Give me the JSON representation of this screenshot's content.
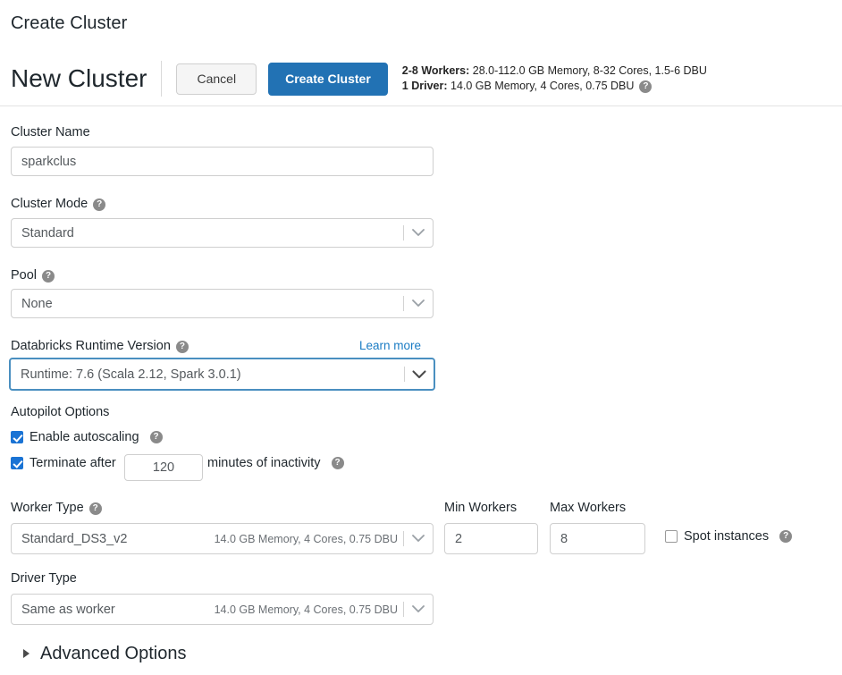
{
  "page": {
    "title": "Create Cluster"
  },
  "header": {
    "cluster_heading": "New Cluster",
    "cancel_label": "Cancel",
    "create_label": "Create Cluster",
    "specs": {
      "workers_prefix": "2-8 Workers:",
      "workers_detail": " 28.0-112.0 GB Memory, 8-32 Cores, 1.5-6 DBU",
      "driver_prefix": "1 Driver:",
      "driver_detail": " 14.0 GB Memory, 4 Cores, 0.75 DBU",
      "help_icon": "help-icon",
      "help_glyph": "?"
    },
    "accent_color": "#2272b4"
  },
  "form": {
    "cluster_name": {
      "label": "Cluster Name",
      "value": "sparkclus",
      "placeholder": "Cluster Name"
    },
    "cluster_mode": {
      "label": "Cluster Mode",
      "help_glyph": "?",
      "value": "Standard",
      "chevron_icon": "chevron-down-icon"
    },
    "pool": {
      "label": "Pool",
      "help_glyph": "?",
      "value": "None",
      "chevron_icon": "chevron-down-icon"
    },
    "runtime": {
      "label": "Databricks Runtime Version",
      "help_glyph": "?",
      "learn_more": "Learn more",
      "value": "Runtime: 7.6 (Scala 2.12, Spark 3.0.1)",
      "chevron_icon": "chevron-down-icon",
      "focus_color": "#4a8fc0"
    },
    "autopilot": {
      "label": "Autopilot Options",
      "autoscaling_label": "Enable autoscaling",
      "autoscaling_checked": true,
      "autoscaling_help_glyph": "?",
      "terminate_label": "Terminate after",
      "terminate_checked": true,
      "terminate_value": "120",
      "terminate_suffix": "minutes of inactivity",
      "terminate_help_glyph": "?"
    },
    "worker_type": {
      "label": "Worker Type",
      "help_glyph": "?",
      "value": "Standard_DS3_v2",
      "spec": "14.0 GB Memory, 4 Cores, 0.75 DBU",
      "chevron_icon": "chevron-down-icon"
    },
    "min_workers": {
      "label": "Min Workers",
      "value": "2"
    },
    "max_workers": {
      "label": "Max Workers",
      "value": "8"
    },
    "spot_instances": {
      "label": "Spot instances",
      "checked": false,
      "help_glyph": "?"
    },
    "driver_type": {
      "label": "Driver Type",
      "value": "Same as worker",
      "spec": "14.0 GB Memory, 4 Cores, 0.75 DBU",
      "chevron_icon": "chevron-down-icon"
    },
    "advanced_options": {
      "label": "Advanced Options",
      "caret_icon": "caret-right-icon",
      "expanded": false
    }
  }
}
